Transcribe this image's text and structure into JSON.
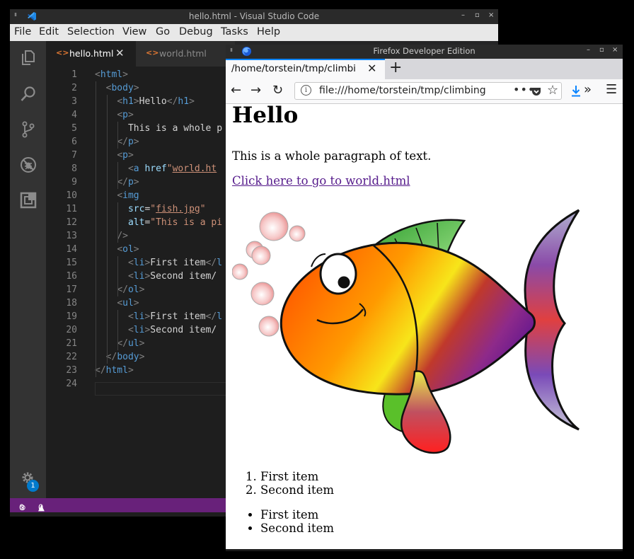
{
  "vscode": {
    "window_title": "hello.html - Visual Studio Code",
    "menu": [
      "File",
      "Edit",
      "Selection",
      "View",
      "Go",
      "Debug",
      "Tasks",
      "Help"
    ],
    "activity_icons": [
      "explorer-icon",
      "search-icon",
      "source-control-icon",
      "debug-icon",
      "extensions-icon"
    ],
    "settings_badge": "1",
    "tabs": [
      {
        "label": "hello.html",
        "active": true
      },
      {
        "label": "world.html",
        "active": false
      }
    ],
    "lines": [
      {
        "n": "1",
        "code": "<html>"
      },
      {
        "n": "2",
        "code": "  <body>"
      },
      {
        "n": "3",
        "code": "    <h1>Hello</h1>"
      },
      {
        "n": "4",
        "code": "    <p>"
      },
      {
        "n": "5",
        "code": "      This is a whole p"
      },
      {
        "n": "6",
        "code": "    </p>"
      },
      {
        "n": "7",
        "code": "    <p>"
      },
      {
        "n": "8",
        "code": "      <a href=\"world.ht"
      },
      {
        "n": "9",
        "code": "    </p>"
      },
      {
        "n": "10",
        "code": "    <img"
      },
      {
        "n": "11",
        "code": "      src=\"fish.jpg\""
      },
      {
        "n": "12",
        "code": "      alt=\"This is a pi"
      },
      {
        "n": "13",
        "code": "    />"
      },
      {
        "n": "14",
        "code": "    <ol>"
      },
      {
        "n": "15",
        "code": "      <li>First item</l"
      },
      {
        "n": "16",
        "code": "      <li>Second item</"
      },
      {
        "n": "17",
        "code": "    </ol>"
      },
      {
        "n": "18",
        "code": "    <ul>"
      },
      {
        "n": "19",
        "code": "      <li>First item</l"
      },
      {
        "n": "20",
        "code": "      <li>Second item</"
      },
      {
        "n": "21",
        "code": "    </ul>"
      },
      {
        "n": "22",
        "code": "  </body>"
      },
      {
        "n": "23",
        "code": "</html>"
      },
      {
        "n": "24",
        "code": ""
      }
    ],
    "status": {
      "errors": "0",
      "warnings": "0"
    }
  },
  "firefox": {
    "window_title": "Firefox Developer Edition",
    "tab_label": "/home/torstein/tmp/climbi",
    "url": "file:///home/torstein/tmp/climbing",
    "page": {
      "heading": "Hello",
      "paragraph": "This is a whole paragraph of text.",
      "link": "Click here to go to world.html",
      "ordered_list": [
        "First item",
        "Second item"
      ],
      "unordered_list": [
        "First item",
        "Second item"
      ]
    }
  },
  "colors": {
    "vscode_status": "#68217a",
    "ff_accent": "#0a84ff",
    "link_visited": "#551a8b"
  }
}
